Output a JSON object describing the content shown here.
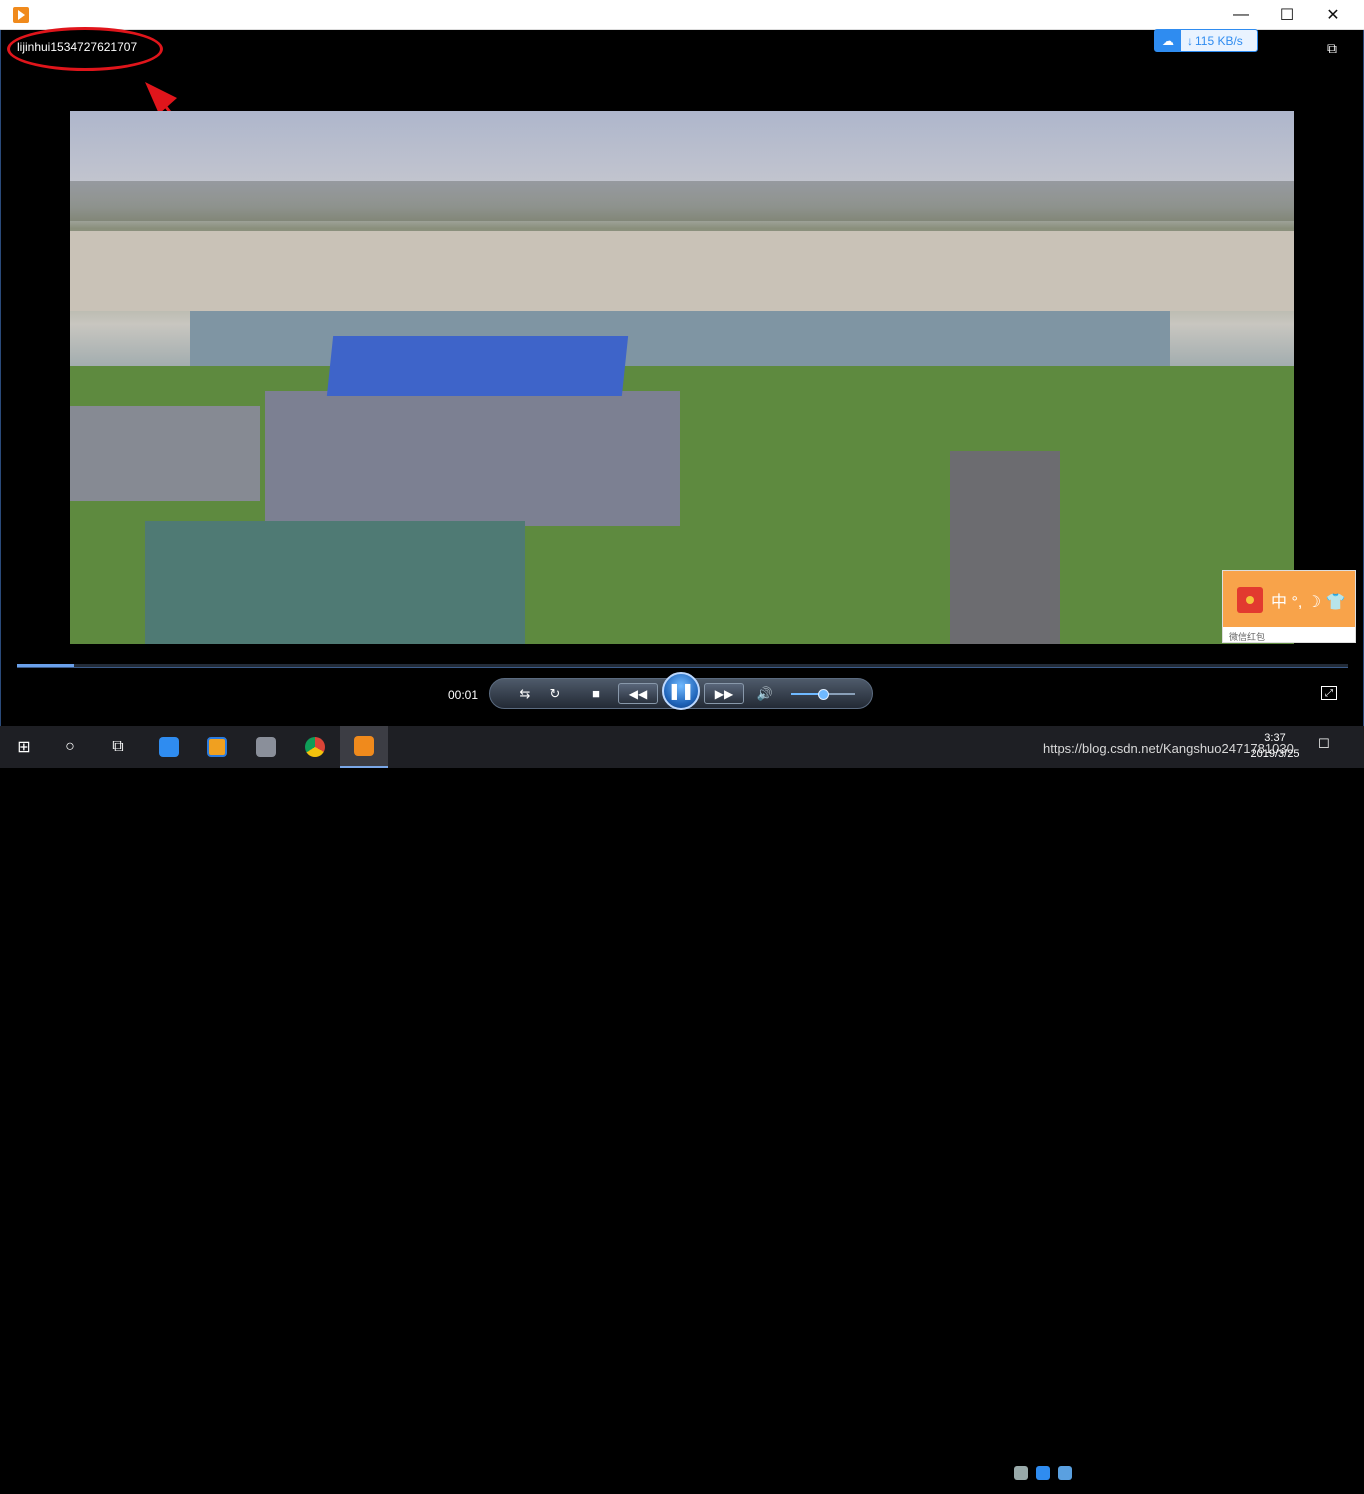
{
  "titlebar": {
    "minimize_glyph": "—",
    "maximize_glyph": "☐",
    "close_glyph": "✕"
  },
  "player": {
    "username": "lijinhui1534727621707",
    "speed": "115 KB/s",
    "speed_arrow": "↓",
    "mini_mode_glyph": "⧉",
    "time": "00:01",
    "progress_fraction": 0.043,
    "volume_fraction": 0.5,
    "controls": {
      "shuffle_glyph": "⇆",
      "repeat_glyph": "↻",
      "stop_glyph": "■",
      "rewind_glyph": "◀◀",
      "pause_glyph": "❚❚",
      "forward_glyph": "▶▶",
      "volume_glyph": "🔊",
      "fullscreen_glyph": "⤢"
    }
  },
  "ad_popup": {
    "ime_text": "中 °, ☽ 👕",
    "label": "微信红包"
  },
  "taskbar": {
    "start_glyph": "⊞",
    "search_glyph": "○",
    "taskview_glyph": "⧉",
    "clock_time": "3:37",
    "clock_date": "2019/3/25",
    "watermark": "https://blog.csdn.net/Kangshuo2471781030",
    "notification_glyph": "☐"
  },
  "colors": {
    "accent": "#2f8cf0",
    "annotation": "#e0151b",
    "player_bg": "#000000",
    "taskbar_bg": "#1e1f24"
  }
}
